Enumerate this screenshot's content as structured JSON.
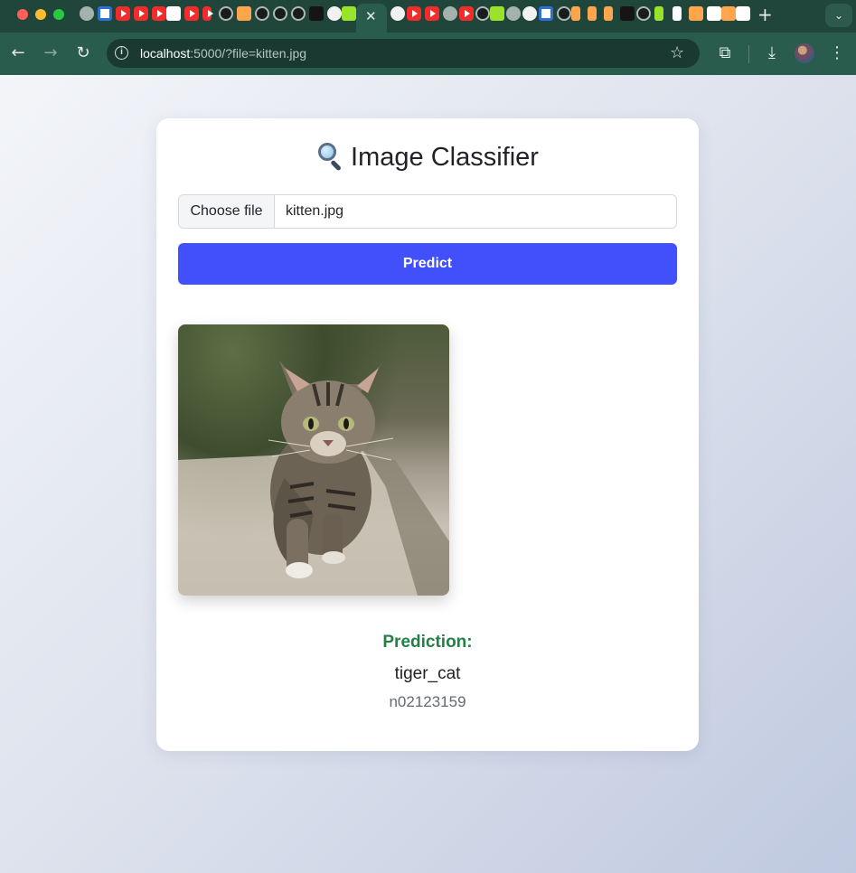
{
  "browser": {
    "tab_close_glyph": "✕",
    "new_tab_glyph": "+",
    "tab_search_glyph": "⌄",
    "url_host": "localhost",
    "url_rest": ":5000/?file=kitten.jpg",
    "icons": [
      "back-arrow-icon",
      "forward-arrow-icon",
      "reload-icon",
      "site-info-icon",
      "bookmark-star-icon",
      "extensions-icon",
      "downloads-icon",
      "profile-avatar",
      "more-menu-icon"
    ]
  },
  "page": {
    "title": "Image Classifier",
    "title_icon": "magnifying-glass-icon",
    "file_input": {
      "button_label": "Choose file",
      "file_name": "kitten.jpg"
    },
    "predict_label": "Predict",
    "image": {
      "subject": "kitten-photo"
    },
    "result": {
      "label": "Prediction:",
      "class_name": "tiger_cat",
      "class_id": "n02123159"
    }
  },
  "colors": {
    "accent": "#4150fa",
    "prediction_label": "#238046",
    "browser_frame": "#20463b"
  }
}
